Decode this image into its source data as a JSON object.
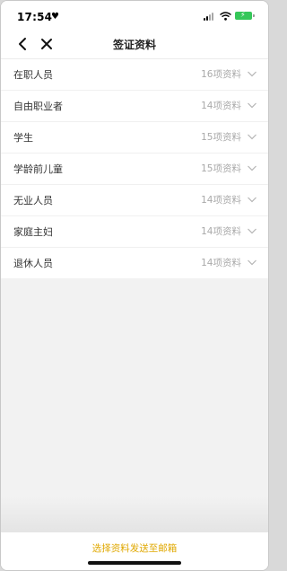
{
  "status_bar": {
    "time": "17:54",
    "heart_icon": "heart-icon",
    "signal_icon": "signal-icon",
    "wifi_icon": "wifi-icon",
    "battery_icon": "battery-charging-icon",
    "battery_color": "#35c759"
  },
  "nav": {
    "title": "签证资料",
    "back_icon": "chevron-left-icon",
    "close_icon": "close-icon"
  },
  "list": {
    "items": [
      {
        "label": "在职人员",
        "count": "16项资料"
      },
      {
        "label": "自由职业者",
        "count": "14项资料"
      },
      {
        "label": "学生",
        "count": "15项资料"
      },
      {
        "label": "学龄前儿童",
        "count": "15项资料"
      },
      {
        "label": "无业人员",
        "count": "14项资料"
      },
      {
        "label": "家庭主妇",
        "count": "14项资料"
      },
      {
        "label": "退休人员",
        "count": "14项资料"
      }
    ],
    "chevron_icon": "chevron-down-icon"
  },
  "bottom": {
    "send_label": "选择资料发送至邮箱",
    "accent_color": "#e0a800"
  }
}
